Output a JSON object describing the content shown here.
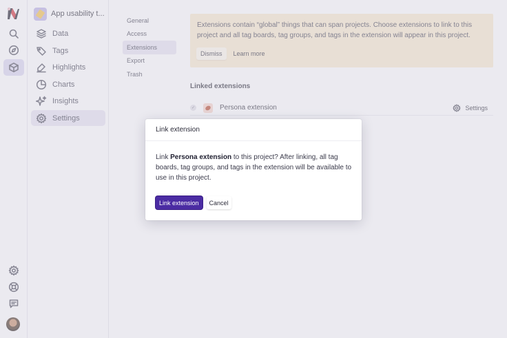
{
  "project": {
    "name": "App usability t..."
  },
  "rail": {
    "items": [
      {
        "icon": "search-icon"
      },
      {
        "icon": "compass-icon"
      },
      {
        "icon": "cube-icon"
      }
    ],
    "bottom": [
      {
        "icon": "gear-icon"
      },
      {
        "icon": "lifebuoy-icon"
      },
      {
        "icon": "chat-icon"
      }
    ]
  },
  "sidebar": {
    "items": [
      {
        "label": "Data",
        "icon": "layers-icon"
      },
      {
        "label": "Tags",
        "icon": "tag-icon"
      },
      {
        "label": "Highlights",
        "icon": "highlighter-icon"
      },
      {
        "label": "Charts",
        "icon": "pie-chart-icon"
      },
      {
        "label": "Insights",
        "icon": "sparkle-icon"
      },
      {
        "label": "Settings",
        "icon": "gear-icon"
      }
    ]
  },
  "settings_nav": {
    "items": [
      "General",
      "Access",
      "Extensions",
      "Export",
      "Trash"
    ],
    "active": "Extensions"
  },
  "banner": {
    "text": "Extensions contain “global” things that can span projects. Choose extensions to link to this project and all tag boards, tag groups, and tags in the extension will appear in this project.",
    "dismiss_label": "Dismiss",
    "learn_more_label": "Learn more"
  },
  "linked_extensions": {
    "title": "Linked extensions",
    "items": [
      {
        "name": "Persona extension",
        "settings_label": "Settings"
      }
    ]
  },
  "modal": {
    "title": "Link extension",
    "body_prefix": "Link ",
    "body_bold": "Persona extension",
    "body_suffix": " to this project? After linking, all tag boards, tag groups, and tags in the extension will be available to use in this project.",
    "confirm_label": "Link extension",
    "cancel_label": "Cancel"
  },
  "colors": {
    "accent": "#4b2ca3",
    "banner_bg": "#f6e7cd",
    "active_nav": "#e4e1f1"
  }
}
